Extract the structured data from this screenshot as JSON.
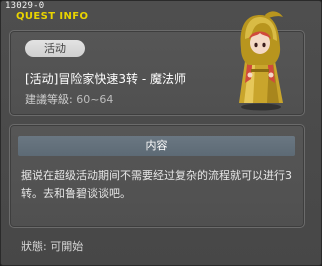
{
  "window": {
    "id_label": "13029-0",
    "title": "QUEST INFO"
  },
  "quest": {
    "tag": "活动",
    "name": "[活动]冒险家快速3转 - 魔法师",
    "level_label": "建議等級:",
    "level_value": "60~64"
  },
  "description": {
    "header": "内容",
    "text": "据说在超级活动期间不需要经过复杂的流程就可以进行3转。去和鲁碧谈谈吧。"
  },
  "status": {
    "label": "狀態:",
    "value": "可開始"
  },
  "npc": {
    "icon": "hooded-mage-npc-icon"
  }
}
